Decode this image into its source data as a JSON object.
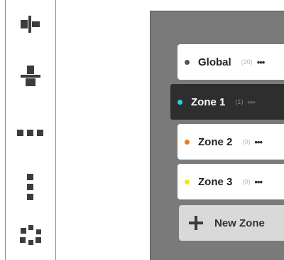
{
  "toolbar": {
    "tools": [
      {
        "icon": "align-horizontal-centers-icon"
      },
      {
        "icon": "align-vertical-centers-icon"
      },
      {
        "icon": "distribute-horizontal-icon"
      },
      {
        "icon": "distribute-vertical-icon"
      },
      {
        "icon": "scatter-grid-icon"
      }
    ]
  },
  "zones": {
    "items": [
      {
        "name": "Global",
        "count": "(20)",
        "menu": "•••",
        "color": "#555555",
        "active": false
      },
      {
        "name": "Zone 1",
        "count": "(1)",
        "menu": "•••",
        "color": "#22d3e6",
        "active": true
      },
      {
        "name": "Zone 2",
        "count": "(0)",
        "menu": "•••",
        "color": "#f07b1c",
        "active": false
      },
      {
        "name": "Zone 3",
        "count": "(0)",
        "menu": "•••",
        "color": "#f2e81a",
        "active": false
      }
    ],
    "new_zone_label": "New Zone"
  },
  "colors": {
    "panel_bg": "#7a7a7a",
    "active_zone_bg": "#2e2e2e",
    "new_zone_bg": "#d9d9d9"
  }
}
